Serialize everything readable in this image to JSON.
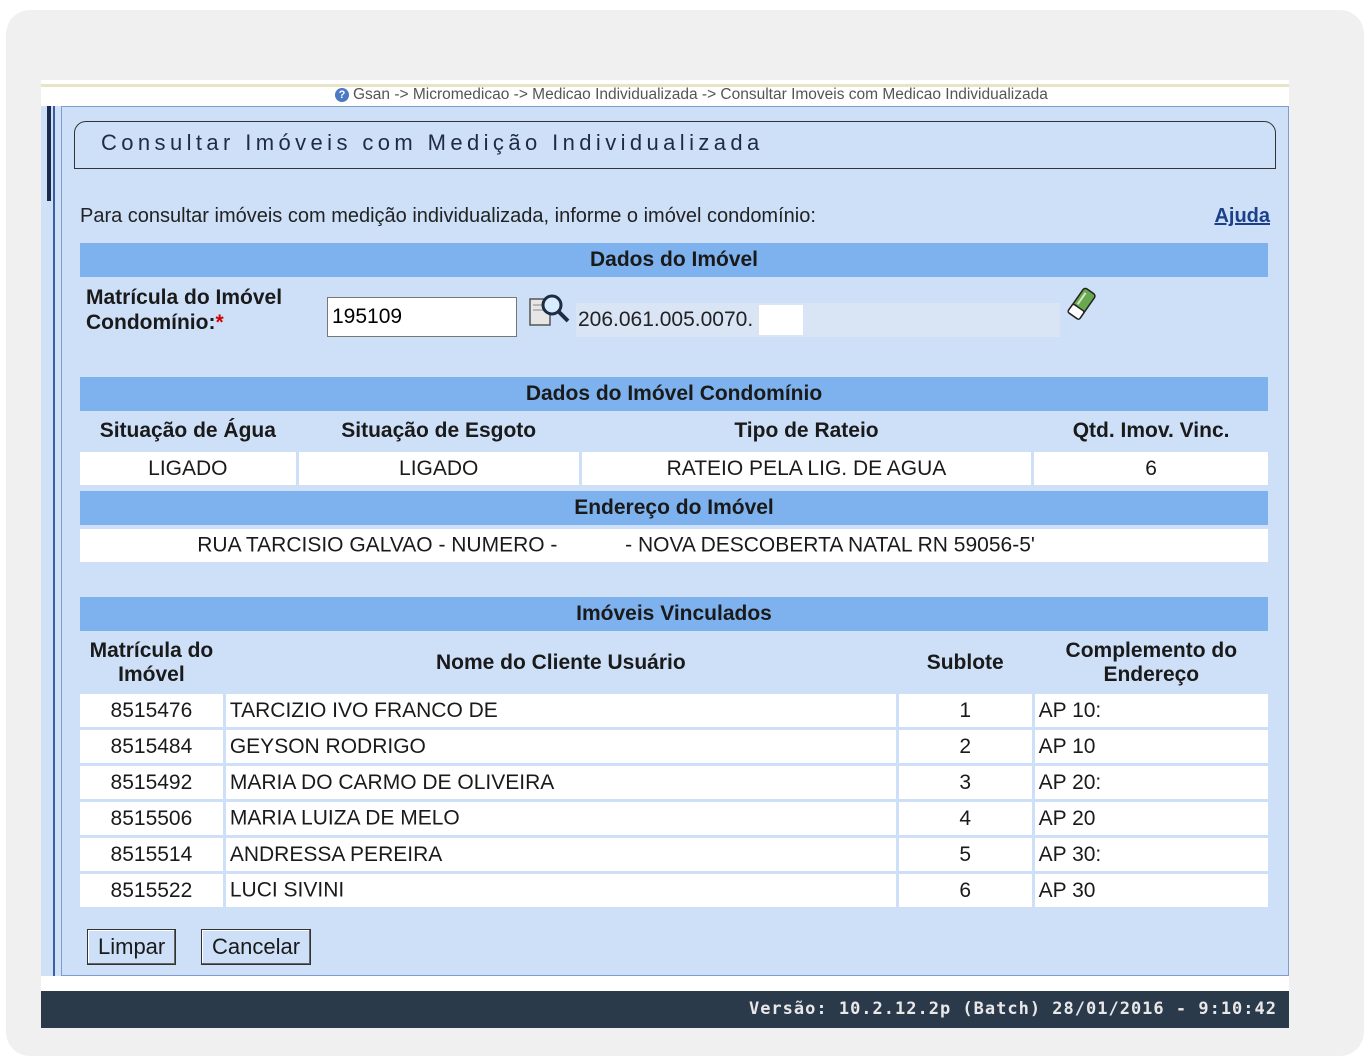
{
  "breadcrumb": "Gsan -> Micromedicao -> Medicao Individualizada -> Consultar Imoveis com Medicao Individualizada",
  "page_title": "Consultar Imóveis com Medição Individualizada",
  "intro": "Para consultar imóveis com medição individualizada, informe o imóvel condomínio:",
  "help_link": "Ajuda",
  "dados_imovel": {
    "header": "Dados do Imóvel",
    "label_line1": "Matrícula do Imóvel",
    "label_line2": "Condomínio:",
    "required_mark": "*",
    "matricula_value": "195109",
    "inscricao": "206.061.005.0070."
  },
  "condominio": {
    "header": "Dados do Imóvel Condomínio",
    "columns": [
      "Situação de Água",
      "Situação de Esgoto",
      "Tipo de Rateio",
      "Qtd. Imov. Vinc."
    ],
    "values": [
      "LIGADO",
      "LIGADO",
      "RATEIO PELA LIG. DE AGUA",
      "6"
    ],
    "endereco_header": "Endereço do Imóvel",
    "endereco_part1": "RUA TARCISIO GALVAO - NUMERO -",
    "endereco_part2": "- NOVA DESCOBERTA NATAL RN 59056-5",
    "endereco_tail": "'"
  },
  "vinculados": {
    "header": "Imóveis Vinculados",
    "columns": {
      "matricula_1": "Matrícula do",
      "matricula_2": "Imóvel",
      "nome": "Nome do Cliente Usuário",
      "sublote": "Sublote",
      "complemento_1": "Complemento do",
      "complemento_2": "Endereço"
    },
    "rows": [
      {
        "matricula": "8515476",
        "nome": "TARCIZIO IVO FRANCO DE",
        "sublote": "1",
        "complemento": "AP 10:"
      },
      {
        "matricula": "8515484",
        "nome": "GEYSON RODRIGO",
        "sublote": "2",
        "complemento": "AP 10"
      },
      {
        "matricula": "8515492",
        "nome": "MARIA DO CARMO DE OLIVEIRA",
        "sublote": "3",
        "complemento": "AP 20:"
      },
      {
        "matricula": "8515506",
        "nome": "MARIA LUIZA DE MELO",
        "sublote": "4",
        "complemento": "AP 20"
      },
      {
        "matricula": "8515514",
        "nome": "ANDRESSA PEREIRA",
        "sublote": "5",
        "complemento": "AP 30:"
      },
      {
        "matricula": "8515522",
        "nome": "LUCI SIVINI",
        "sublote": "6",
        "complemento": "AP 30"
      }
    ]
  },
  "buttons": {
    "limpar": "Limpar",
    "cancelar": "Cancelar"
  },
  "version": "Versão: 10.2.12.2p (Batch) 28/01/2016 - 9:10:42",
  "icons": {
    "help": "help-circle-icon",
    "search": "magnifier-icon",
    "eraser": "eraser-icon"
  },
  "colors": {
    "panel_bg": "#cde0f8",
    "section_header": "#7db2ee",
    "version_bar": "#2b3a4a"
  }
}
